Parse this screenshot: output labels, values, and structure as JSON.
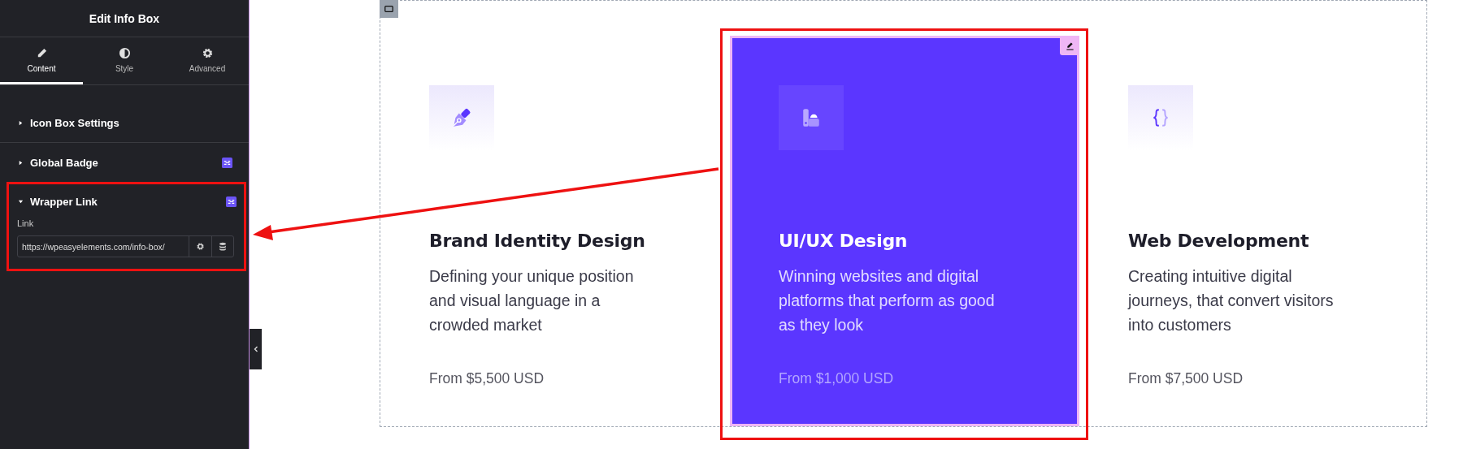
{
  "panel": {
    "title": "Edit Info Box",
    "tabs": [
      {
        "label": "Content",
        "selected": true
      },
      {
        "label": "Style",
        "selected": false
      },
      {
        "label": "Advanced",
        "selected": false
      }
    ],
    "sections": [
      {
        "title": "Icon Box Settings",
        "expanded": false,
        "badge": false,
        "highlighted": false
      },
      {
        "title": "Global Badge",
        "expanded": false,
        "badge": true,
        "highlighted": false
      },
      {
        "title": "Wrapper Link",
        "expanded": true,
        "badge": true,
        "highlighted": true,
        "field": {
          "label": "Link",
          "value": "https://wpeasyelements.com/info-box/"
        }
      }
    ]
  },
  "cards": [
    {
      "title": "Brand Identity Design",
      "description": "Defining your unique position and visual language in a crowded market",
      "price": "From $5,500 USD",
      "selected": false
    },
    {
      "title": "UI/UX Design",
      "description": "Winning websites and digital platforms that perform as good as they look",
      "price": "From $1,000 USD",
      "selected": true
    },
    {
      "title": "Web Development",
      "description": "Creating intuitive digital journeys, that convert visitors into customers",
      "price": "From $7,500 USD",
      "selected": false
    }
  ]
}
